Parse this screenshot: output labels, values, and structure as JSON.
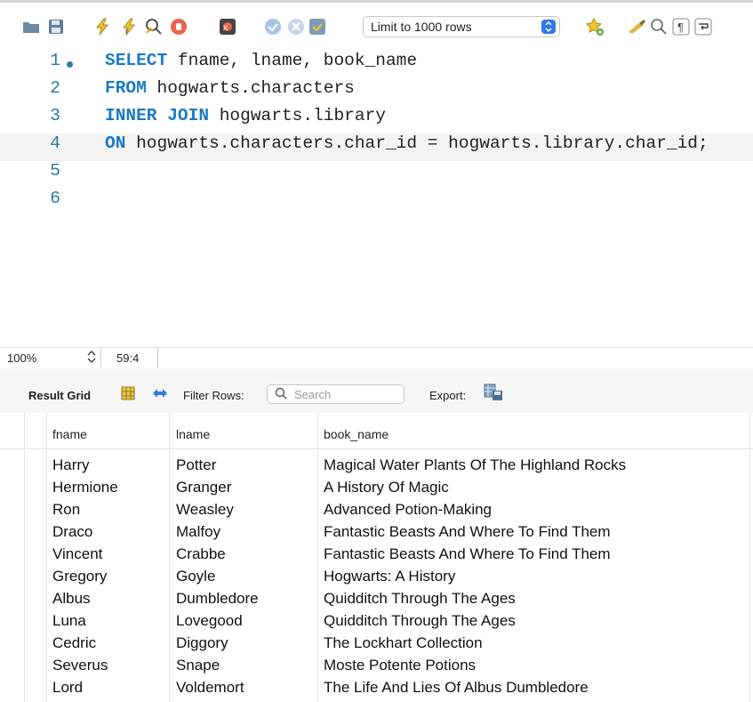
{
  "toolbar": {
    "limit_select": "Limit to 1000 rows",
    "icons": [
      "folder-icon",
      "save-icon",
      "execute-icon",
      "execute-current-icon",
      "explain-icon",
      "stop-icon",
      "toggle-errors-icon",
      "commit-icon",
      "rollback-icon",
      "autocommit-icon",
      "beautify-icon",
      "favorites-icon",
      "cleanup-icon",
      "find-icon",
      "invisible-chars-icon",
      "wrap-icon"
    ]
  },
  "editor": {
    "lines": [
      {
        "num": "1",
        "kw": "SELECT",
        "rest": " fname, lname, book_name"
      },
      {
        "num": "2",
        "kw": "FROM",
        "rest": " hogwarts.characters"
      },
      {
        "num": "3",
        "kw": "INNER JOIN",
        "rest": " hogwarts.library"
      },
      {
        "num": "4",
        "kw": "ON",
        "rest": " hogwarts.characters.char_id = hogwarts.library.char_id;"
      },
      {
        "num": "5",
        "kw": "",
        "rest": ""
      },
      {
        "num": "6",
        "kw": "",
        "rest": ""
      }
    ]
  },
  "status": {
    "zoom": "100%",
    "position": "59:4"
  },
  "result_bar": {
    "result_grid": "Result Grid",
    "filter_rows": "Filter Rows:",
    "search_placeholder": "Search",
    "export": "Export:"
  },
  "grid": {
    "columns": [
      "fname",
      "lname",
      "book_name"
    ],
    "rows": [
      [
        "Harry",
        "Potter",
        "Magical Water Plants Of The Highland Rocks"
      ],
      [
        "Hermione",
        "Granger",
        "A History Of Magic"
      ],
      [
        "Ron",
        "Weasley",
        "Advanced Potion-Making"
      ],
      [
        "Draco",
        "Malfoy",
        "Fantastic Beasts And Where To Find Them"
      ],
      [
        "Vincent",
        "Crabbe",
        "Fantastic Beasts And Where To Find Them"
      ],
      [
        "Gregory",
        "Goyle",
        "Hogwarts: A History"
      ],
      [
        "Albus",
        "Dumbledore",
        "Quidditch Through The Ages"
      ],
      [
        "Luna",
        "Lovegood",
        "Quidditch Through The Ages"
      ],
      [
        "Cedric",
        "Diggory",
        "The Lockhart Collection"
      ],
      [
        "Severus",
        "Snape",
        "Moste Potente Potions"
      ],
      [
        "Lord",
        "Voldemort",
        "The Life And Lies Of Albus Dumbledore"
      ]
    ]
  },
  "colors": {
    "keyword": "#1a79c6",
    "line_number": "#2b7b9c",
    "accent": "#2f7ae5"
  }
}
